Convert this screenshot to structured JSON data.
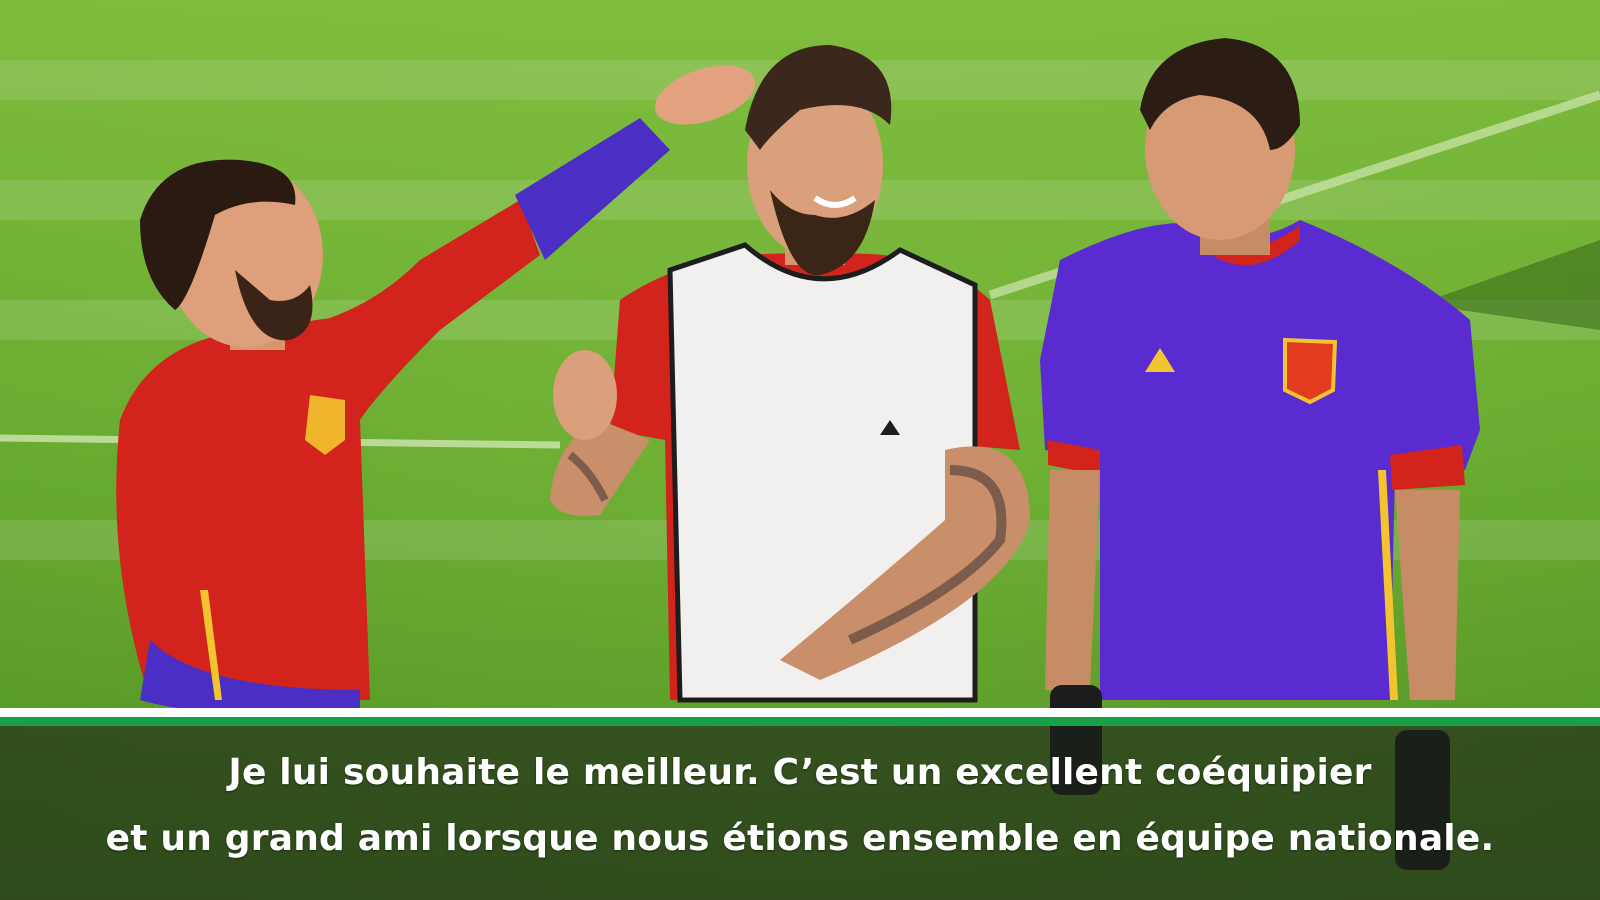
{
  "subtitle": {
    "line1": "Je lui souhaite le meilleur. C’est un excellent coéquipier",
    "line2": "et un grand ami lorsque nous étions ensemble en équipe nationale."
  },
  "colors": {
    "pitch": "#5fa52a",
    "caption_accent": "#18a046",
    "caption_rule": "#ffffff",
    "jersey_red": "#d2231c",
    "jersey_purple": "#5a2bd0",
    "bib_white": "#f1f0ef"
  },
  "scene": {
    "description_icons": [
      "player-left-icon",
      "player-center-icon",
      "player-right-icon"
    ]
  }
}
